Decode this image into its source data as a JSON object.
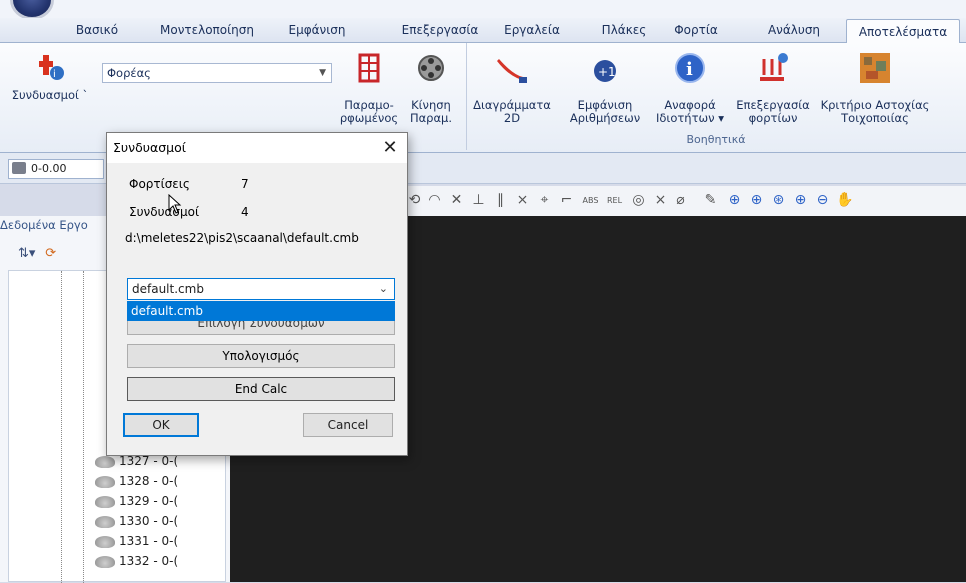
{
  "tabs": [
    "Βασικό",
    "Μοντελοποίηση",
    "Εμφάνιση",
    "Επεξεργασία",
    "Εργαλεία",
    "Πλάκες",
    "Φορτία",
    "Ανάλυση",
    "Αποτελέσματα"
  ],
  "active_tab": "Αποτελέσματα",
  "ribbon": {
    "combinations_label": "Συνδυασμοί `",
    "structure_combo_value": "Φορέας",
    "deformed_label_1": "Παραμο-",
    "deformed_label_2": "ρφωμένος",
    "motion_label_1": "Κίνηση",
    "motion_label_2": "Παραμ.",
    "diagrams_label_1": "Διαγράμματα",
    "diagrams_label_2": "2D",
    "show_numbers_label_1": "Εμφάνιση",
    "show_numbers_label_2": "Αριθμήσεων",
    "report_label_1": "Αναφορά",
    "report_label_2": "Ιδιοτήτων ▾",
    "loads_processing_label_1": "Επεξεργασία",
    "loads_processing_label_2": "φορτίων",
    "masonry_label_1": "Κριτήριο Αστοχίας",
    "masonry_label_2": "Τοιχοποιίας",
    "group_helpers": "Βοηθητικά"
  },
  "toolbar": {
    "level_value": "0-0.00"
  },
  "left_panel": {
    "header": "Δεδομένα Εργο",
    "tree_items": [
      "1327 - 0-(",
      "1328 - 0-(",
      "1329 - 0-(",
      "1330 - 0-(",
      "1331 - 0-(",
      "1332 - 0-("
    ]
  },
  "dialog": {
    "title": "Συνδυασμοί",
    "loads_label": "Φορτίσεις",
    "loads_count": "7",
    "combos_label": "Συνδυασμοί",
    "combos_count": "4",
    "path": "d:\\meletes22\\pis2\\scaanal\\default.cmb",
    "combo_value": "default.cmb",
    "dropdown_option": "default.cmb",
    "select_button_partial": "Επιλογή Συνδυασμών",
    "calc_button": "Υπολογισμός",
    "end_calc_button": "End Calc",
    "ok_button": "OK",
    "cancel_button": "Cancel"
  },
  "colors": {
    "accent": "#0078d7",
    "canvas": "#1f1f1f",
    "ribbon_text": "#1a2f5a"
  }
}
